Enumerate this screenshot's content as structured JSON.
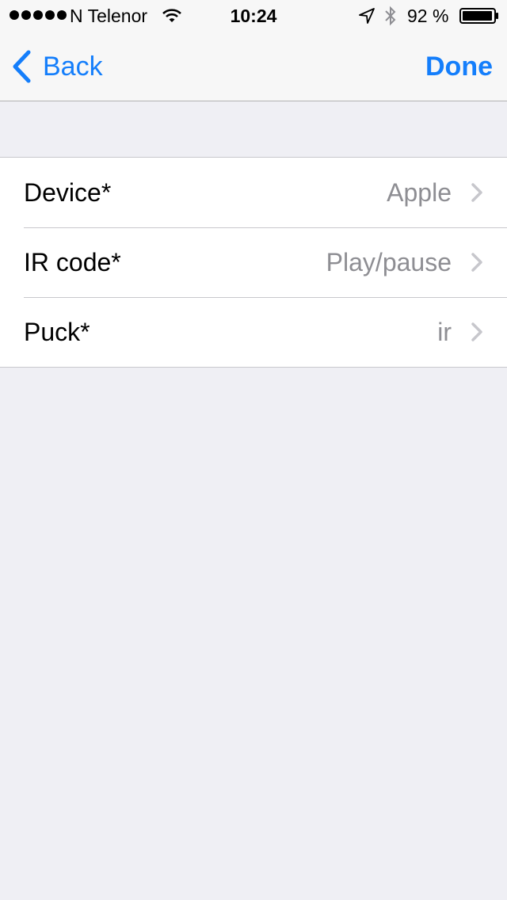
{
  "status_bar": {
    "carrier": "N Telenor",
    "time": "10:24",
    "battery_percent": "92 %",
    "signal_bars": 5
  },
  "nav": {
    "back_label": "Back",
    "done_label": "Done"
  },
  "rows": [
    {
      "label": "Device*",
      "value": "Apple"
    },
    {
      "label": "IR code*",
      "value": "Play/pause"
    },
    {
      "label": "Puck*",
      "value": "ir"
    }
  ],
  "colors": {
    "tint": "#147efb",
    "background": "#efeff4",
    "secondary_text": "#8e8e93"
  }
}
